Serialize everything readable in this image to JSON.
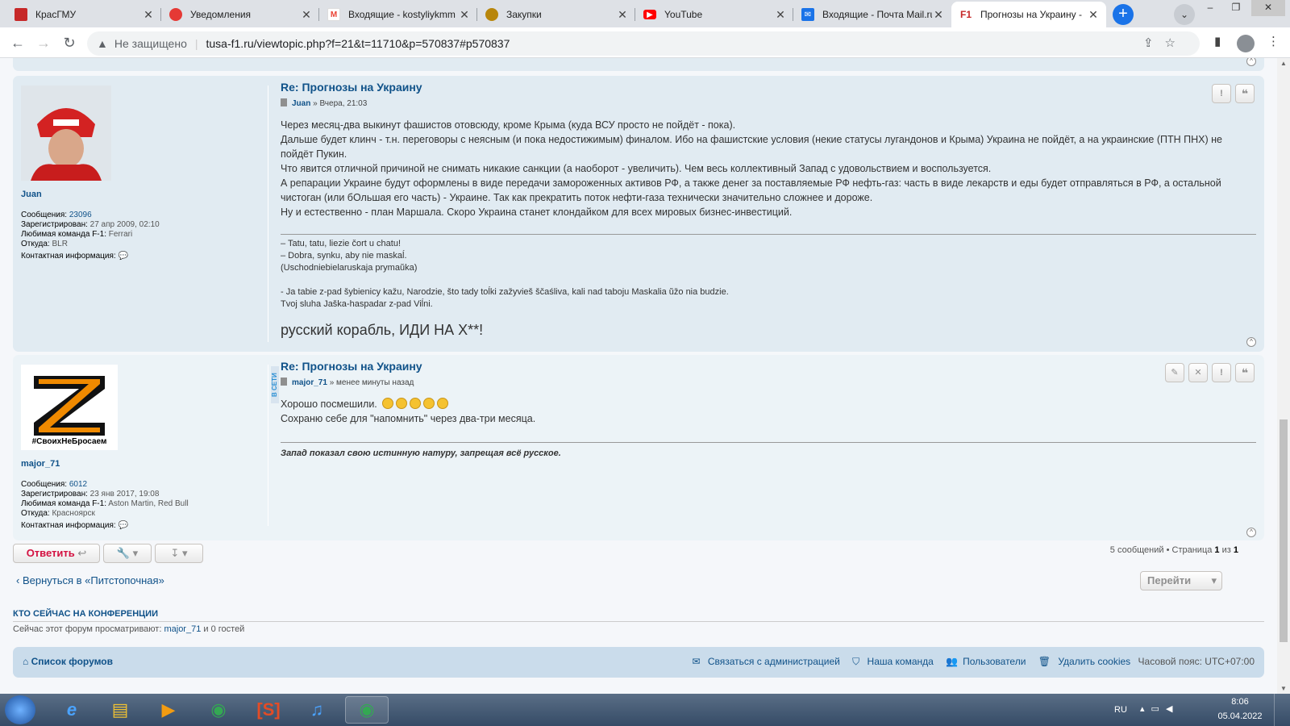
{
  "browser": {
    "tabs": [
      {
        "title": "КрасГМУ",
        "favicon_color": "#c62828"
      },
      {
        "title": "Уведомления",
        "favicon_color": "#e53935"
      },
      {
        "title": "Входящие - kostyliykmm",
        "favicon_color": "#ea4335"
      },
      {
        "title": "Закупки",
        "favicon_color": "#b8860b"
      },
      {
        "title": "YouTube",
        "favicon_color": "#ff0000"
      },
      {
        "title": "Входящие - Почта Mail.ru",
        "favicon_color": "#1a73e8"
      },
      {
        "title": "Прогнозы на Украину -",
        "favicon_color": "#c62828"
      }
    ],
    "security_label": "Не защищено",
    "url": "tusa-f1.ru/viewtopic.php?f=21&t=11710&p=570837#p570837"
  },
  "posts": [
    {
      "title": "Re: Прогнозы на Украину",
      "author": "Juan",
      "time": "Вчера, 21:03",
      "profile": {
        "messages_label": "Сообщения:",
        "messages": "23096",
        "registered_label": "Зарегистрирован:",
        "registered": "27 апр 2009, 02:10",
        "team_label": "Любимая команда F-1:",
        "team": "Ferrari",
        "from_label": "Откуда:",
        "from": "BLR",
        "contact_label": "Контактная информация:"
      },
      "lines": [
        "Через месяц-два выкинут фашистов отовсюду, кроме Крыма (куда ВСУ просто не пойдёт - пока).",
        "Дальше будет клинч - т.н. переговоры с неясным (и пока недостижимым) финалом. Ибо на фашистские условия (некие статусы лугандонов и Крыма) Украина не пойдёт, а на украинские (ПТН ПНХ) не пойдёт Пукин.",
        "Что явится отличной причиной не снимать никакие санкции (а наоборот - увеличить). Чем весь коллективный Запад с удовольствием и воспользуется.",
        "А репарации Украине будут оформлены в виде передачи замороженных активов РФ, а также денег за поставляемые РФ нефть-газ: часть в виде лекарств и еды будет отправляться в РФ, а остальной чистоган (или бОльшая его часть) - Украине. Так как прекратить поток нефти-газа технически значительно сложнее и дороже.",
        "Ну и естественно - план Маршала. Скоро Украина станет клондайком для всех мировых бизнес-инвестиций."
      ],
      "signature": [
        "– Tatu, tatu, liezie čort u chatu!",
        "– Dobra, synku, aby nie maskaĺ.",
        "(Uschodniebielaruskaja prymaŭka)",
        "",
        "- Ja tabie z-pad šybienicy kažu, Narodzie, što tady toĺki zažyvieš ščaśliva, kali nad taboju Maskalia ŭžo nia budzie.",
        "Tvoj sluha Jaška-haspadar z-pad Viĺni."
      ],
      "signature_big": "русский корабль, ИДИ НА Х**!"
    },
    {
      "title": "Re: Прогнозы на Украину",
      "author": "major_71",
      "time": "менее минуты назад",
      "online_label": "В СЕТИ",
      "avatar_caption": "#СвоихНеБросаем",
      "profile": {
        "messages_label": "Сообщения:",
        "messages": "6012",
        "registered_label": "Зарегистрирован:",
        "registered": "23 янв 2017, 19:08",
        "team_label": "Любимая команда F-1:",
        "team": "Aston Martin, Red Bull",
        "from_label": "Откуда:",
        "from": "Красноярск",
        "contact_label": "Контактная информация:"
      },
      "line1": "Хорошо посмешили.",
      "line2": "Сохраню себе для \"напомнить\" через два-три месяца.",
      "signature": "Запад показал свою истинную натуру, запрещая всё русское."
    }
  ],
  "actions": {
    "reply": "Ответить",
    "pagination_prefix": "5 сообщений • Страница",
    "page_current": "1",
    "page_of": "из",
    "page_total": "1",
    "back": "Вернуться в «Питстопочная»",
    "goto": "Перейти"
  },
  "who": {
    "heading": "КТО СЕЙЧАС НА КОНФЕРЕНЦИИ",
    "text_prefix": "Сейчас этот форум просматривают:",
    "user": "major_71",
    "text_suffix": "и 0 гостей"
  },
  "footer": {
    "home": "Список форумов",
    "contact": "Связаться с администрацией",
    "team": "Наша команда",
    "users": "Пользователи",
    "cookies": "Удалить cookies",
    "timezone": "Часовой пояс: UTC+07:00"
  },
  "taskbar": {
    "lang": "RU",
    "time": "8:06",
    "date": "05.04.2022"
  }
}
